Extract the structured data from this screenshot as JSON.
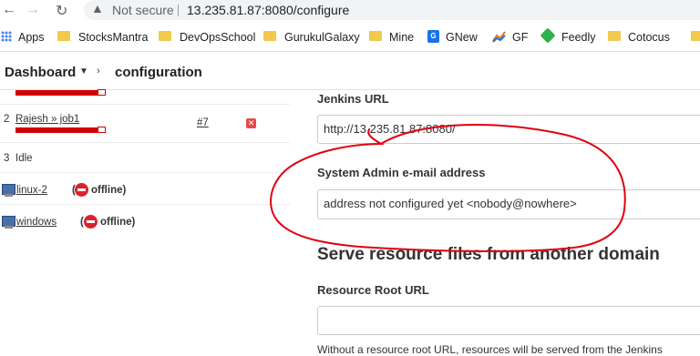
{
  "browser": {
    "security_label": "Not secure",
    "url": "13.235.81.87:8080/configure",
    "bookmarks": [
      {
        "label": "Apps",
        "icon": "apps-grid-icon"
      },
      {
        "label": "StocksMantra",
        "icon": "folder-icon"
      },
      {
        "label": "DevOpsSchool",
        "icon": "folder-icon"
      },
      {
        "label": "GurukulGalaxy",
        "icon": "folder-icon"
      },
      {
        "label": "Mine",
        "icon": "folder-icon"
      },
      {
        "label": "GNew",
        "icon": "google-sheets-icon"
      },
      {
        "label": "GF",
        "icon": "chart-icon"
      },
      {
        "label": "Feedly",
        "icon": "feedly-icon"
      },
      {
        "label": "Cotocus",
        "icon": "folder-icon"
      }
    ]
  },
  "breadcrumb": {
    "root": "Dashboard",
    "current": "configuration"
  },
  "executors": [
    {
      "number": "2",
      "job_link": "Rajesh » job1",
      "build_link": "#7"
    },
    {
      "number": "3",
      "status": "Idle"
    }
  ],
  "nodes": [
    {
      "name": "linux-2",
      "state": "(",
      "state_label": "offline)"
    },
    {
      "name": "windows",
      "state": "(",
      "state_label": "offline)"
    }
  ],
  "config": {
    "jenkins_url_label": "Jenkins URL",
    "jenkins_url_value": "http://13.235.81.87:8080/",
    "admin_email_label": "System Admin e-mail address",
    "admin_email_value": "address not configured yet <nobody@nowhere>",
    "section_title": "Serve resource files from another domain",
    "resource_root_label": "Resource Root URL",
    "resource_root_value": "",
    "help_text": "Without a resource root URL, resources will be served from the Jenkins"
  },
  "colors": {
    "annotation_red": "#e0000f",
    "build_bar_red": "#d10000",
    "offline_red": "#d9232e"
  }
}
